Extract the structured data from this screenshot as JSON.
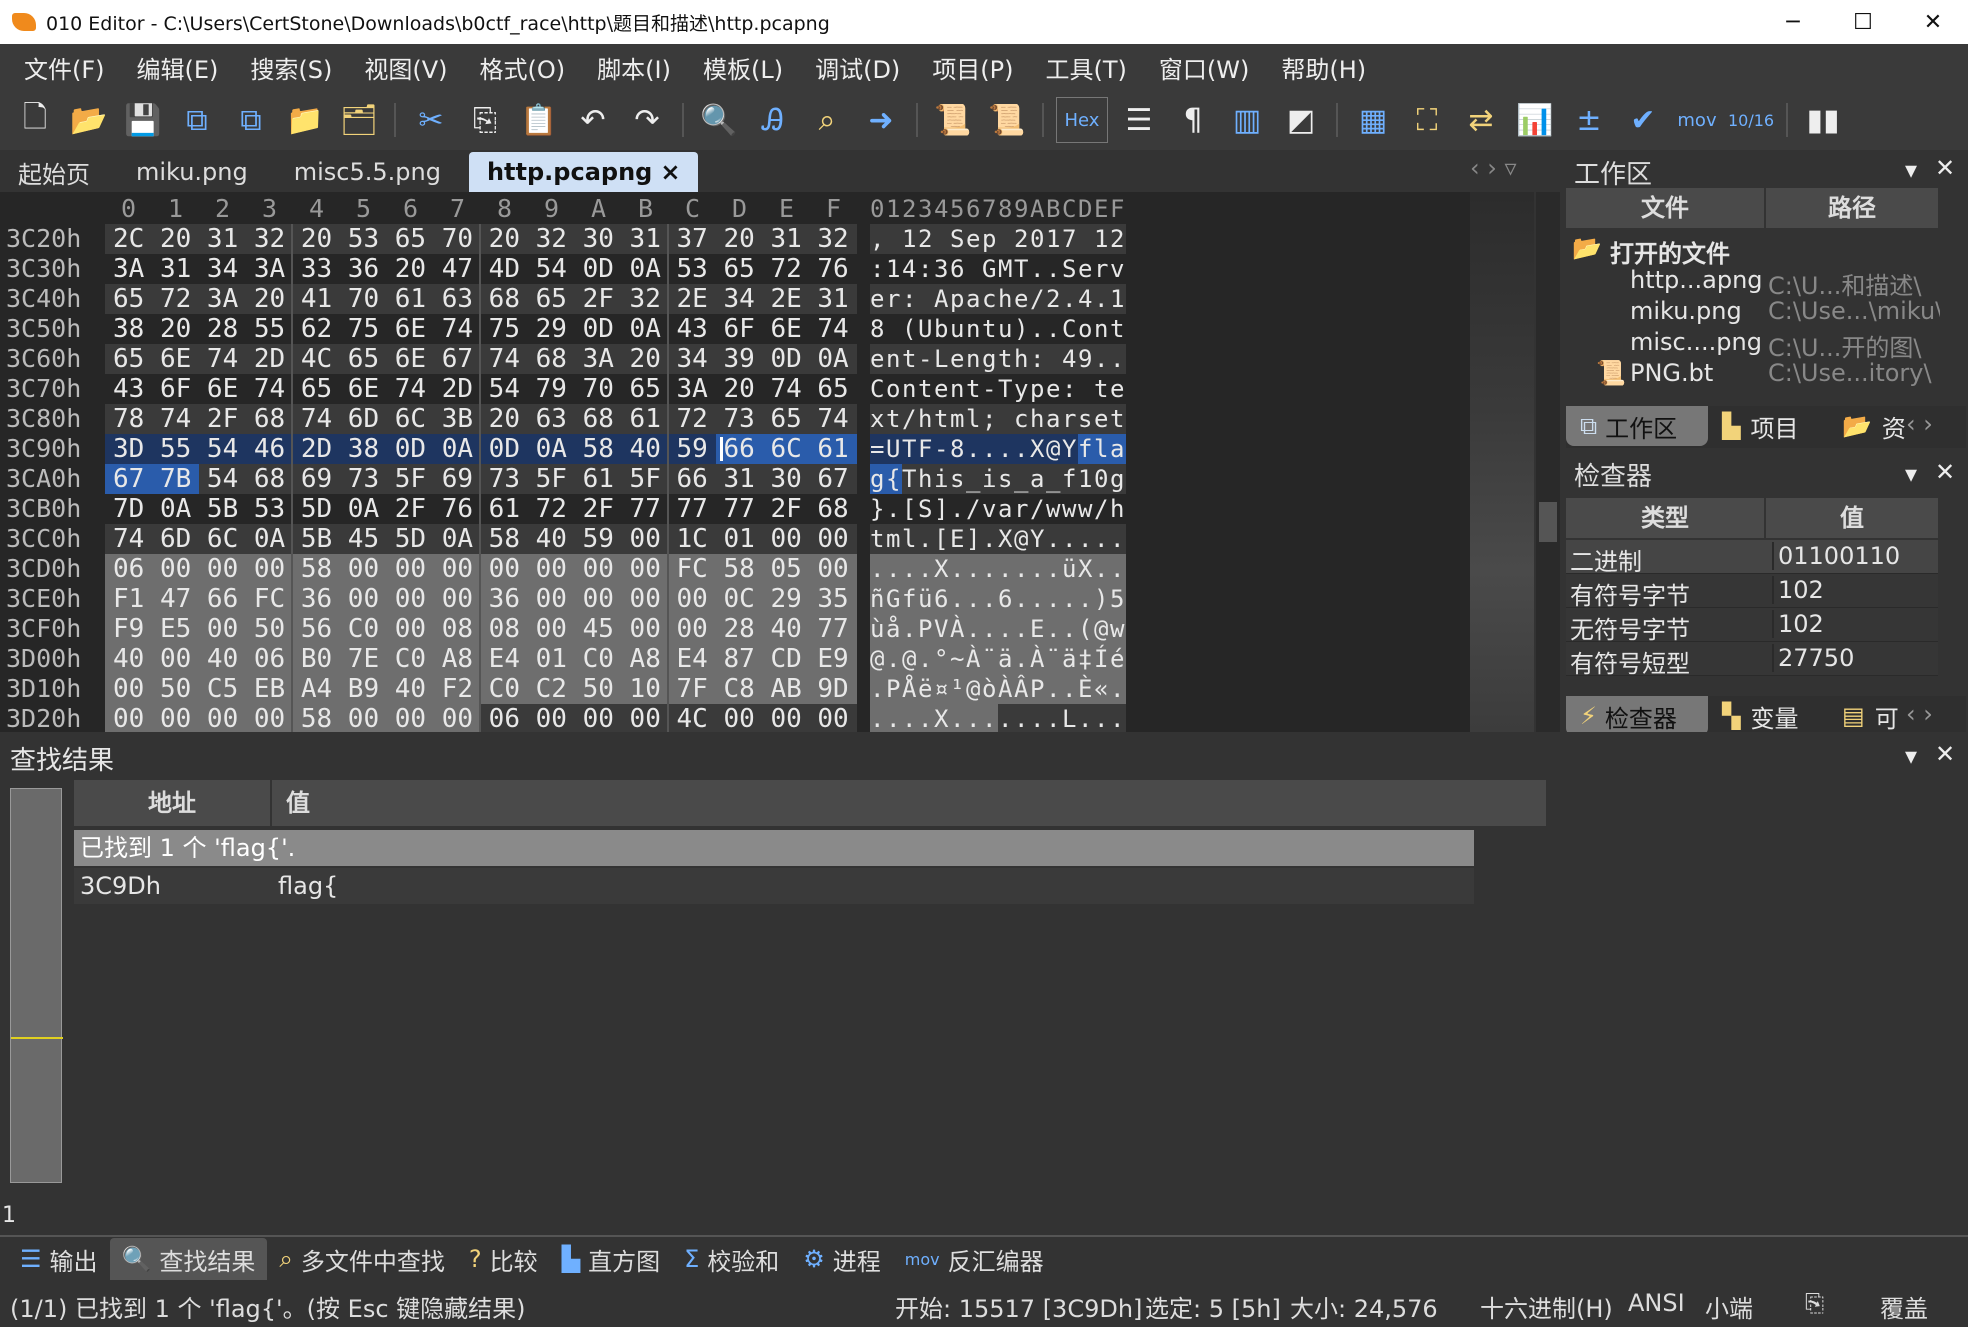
{
  "window": {
    "title": "010 Editor - C:\\Users\\CertStone\\Downloads\\b0ctf_race\\http\\题目和描述\\http.pcapng",
    "minimize": "─",
    "maximize": "☐",
    "close": "✕"
  },
  "menu": [
    "文件(F)",
    "编辑(E)",
    "搜索(S)",
    "视图(V)",
    "格式(O)",
    "脚本(I)",
    "模板(L)",
    "调试(D)",
    "项目(P)",
    "工具(T)",
    "窗口(W)",
    "帮助(H)"
  ],
  "toolbar": {
    "hex_label": "Hex",
    "mov_label": "mov",
    "base_label": "10/16"
  },
  "tabs": [
    {
      "label": "起始页"
    },
    {
      "label": "miku.png"
    },
    {
      "label": "misc5.5.png"
    },
    {
      "label": "http.pcapng",
      "close": "×",
      "active": true
    }
  ],
  "hex": {
    "col_headers": [
      "0",
      "1",
      "2",
      "3",
      "4",
      "5",
      "6",
      "7",
      "8",
      "9",
      "A",
      "B",
      "C",
      "D",
      "E",
      "F"
    ],
    "ascii_header": "0123456789ABCDEF",
    "rows": [
      {
        "addr": "3C20h",
        "bytes": "2C 20 31 32 20 53 65 70 20 32 30 31 37 20 31 32",
        "ascii": ", 12 Sep 2017 12"
      },
      {
        "addr": "3C30h",
        "bytes": "3A 31 34 3A 33 36 20 47 4D 54 0D 0A 53 65 72 76",
        "ascii": ":14:36 GMT..Serv"
      },
      {
        "addr": "3C40h",
        "bytes": "65 72 3A 20 41 70 61 63 68 65 2F 32 2E 34 2E 31",
        "ascii": "er: Apache/2.4.1"
      },
      {
        "addr": "3C50h",
        "bytes": "38 20 28 55 62 75 6E 74 75 29 0D 0A 43 6F 6E 74",
        "ascii": "8 (Ubuntu)..Cont"
      },
      {
        "addr": "3C60h",
        "bytes": "65 6E 74 2D 4C 65 6E 67 74 68 3A 20 34 39 0D 0A",
        "ascii": "ent-Length: 49.."
      },
      {
        "addr": "3C70h",
        "bytes": "43 6F 6E 74 65 6E 74 2D 54 79 70 65 3A 20 74 65",
        "ascii": "Content-Type: te"
      },
      {
        "addr": "3C80h",
        "bytes": "78 74 2F 68 74 6D 6C 3B 20 63 68 61 72 73 65 74",
        "ascii": "xt/html; charset"
      },
      {
        "addr": "3C90h",
        "bytes": "3D 55 54 46 2D 38 0D 0A 0D 0A 58 40 59 66 6C 61",
        "ascii": "=UTF-8....X@Yfla"
      },
      {
        "addr": "3CA0h",
        "bytes": "67 7B 54 68 69 73 5F 69 73 5F 61 5F 66 31 30 67",
        "ascii": "g{This_is_a_f10g"
      },
      {
        "addr": "3CB0h",
        "bytes": "7D 0A 5B 53 5D 0A 2F 76 61 72 2F 77 77 77 2F 68",
        "ascii": "}.[S]./var/www/h"
      },
      {
        "addr": "3CC0h",
        "bytes": "74 6D 6C 0A 5B 45 5D 0A 58 40 59 00 1C 01 00 00",
        "ascii": "tml.[E].X@Y....."
      },
      {
        "addr": "3CD0h",
        "bytes": "06 00 00 00 58 00 00 00 00 00 00 00 FC 58 05 00",
        "ascii": "....X.......üX.."
      },
      {
        "addr": "3CE0h",
        "bytes": "F1 47 66 FC 36 00 00 00 36 00 00 00 00 0C 29 35",
        "ascii": "ñGfü6...6.....)5"
      },
      {
        "addr": "3CF0h",
        "bytes": "F9 E5 00 50 56 C0 00 08 08 00 45 00 00 28 40 77",
        "ascii": "ùå.PVÀ....E..(@w"
      },
      {
        "addr": "3D00h",
        "bytes": "40 00 40 06 B0 7E C0 A8 E4 01 C0 A8 E4 87 CD E9",
        "ascii": "@.@.°~À¨ä.À¨ä‡Íé"
      },
      {
        "addr": "3D10h",
        "bytes": "00 50 C5 EB A4 B9 40 F2 C0 C2 50 10 7F C8 AB 9D",
        "ascii": ".PÅë¤¹@òÀÂP..È«."
      },
      {
        "addr": "3D20h",
        "bytes": "00 00 00 00 58 00 00 00 06 00 00 00 4C 00 00 00",
        "ascii": "....X.......L..."
      }
    ]
  },
  "colors": {
    "selection": "#2a5cab",
    "selection_row": "#1e3560",
    "structure": "#6e6e6e",
    "band_light": "#3a3a3a",
    "band_dark": "#262626"
  },
  "workspace": {
    "title": "工作区",
    "col_file": "文件",
    "col_path": "路径",
    "group": "打开的文件",
    "files": [
      {
        "name": "http...apng",
        "path": "C:\\U...和描述\\"
      },
      {
        "name": "miku.png",
        "path": "C:\\Use...\\miku\\"
      },
      {
        "name": "misc....png",
        "path": "C:\\U...开的图\\"
      },
      {
        "name": "PNG.bt",
        "path": "C:\\Use...itory\\"
      }
    ],
    "tabs": [
      "工作区",
      "项目",
      "资"
    ]
  },
  "inspector": {
    "title": "检查器",
    "col_type": "类型",
    "col_value": "值",
    "rows": [
      {
        "type": "二进制",
        "value": "01100110"
      },
      {
        "type": "有符号字节",
        "value": "102"
      },
      {
        "type": "无符号字节",
        "value": "102"
      },
      {
        "type": "有符号短型",
        "value": "27750"
      }
    ],
    "tabs": [
      "检查器",
      "变量",
      "可"
    ]
  },
  "find": {
    "title": "查找结果",
    "col_addr": "地址",
    "col_value": "值",
    "summary": "已找到 1 个 'flag{'.",
    "results": [
      {
        "addr": "3C9Dh",
        "value": "flag{"
      }
    ],
    "count": "1"
  },
  "bottom_tabs": [
    "输出",
    "查找结果",
    "多文件中查找",
    "比较",
    "直方图",
    "校验和",
    "进程",
    "反汇编器"
  ],
  "status": {
    "message": "(1/1) 已找到 1 个 'flag{'。(按 Esc 键隐藏结果)",
    "start": "开始: 15517 [3C9Dh]",
    "selected": "选定: 5 [5h]",
    "size": "大小: 24,576",
    "mode": "十六进制(H)",
    "encoding": "ANSI",
    "endian": "小端",
    "overwrite": "覆盖"
  }
}
